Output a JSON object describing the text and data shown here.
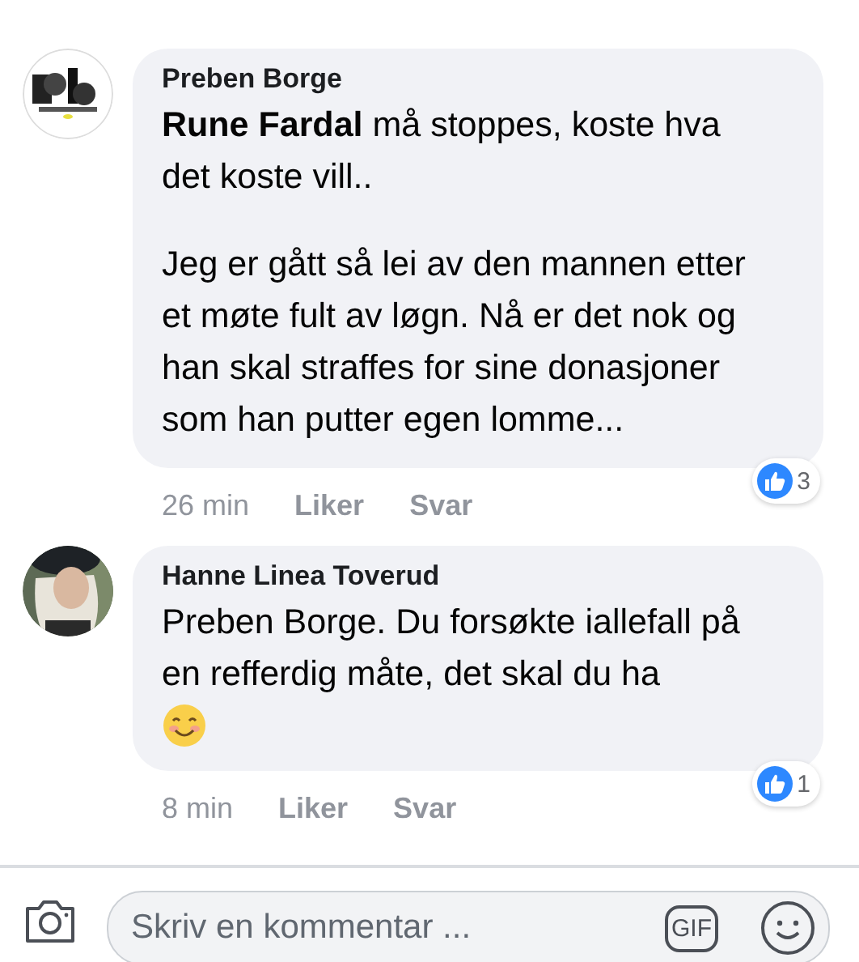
{
  "comments": [
    {
      "author": "Preben Borge",
      "paragraphs": [
        "**Rune Fardal** må stoppes, koste hva det koste vill..",
        "Jeg er gått så lei av den mannen etter et møte fult av løgn. Nå er det nok og han skal straffes for sine donasjoner som han putter egen lomme..."
      ],
      "emoji": false,
      "time": "26 min",
      "like": "Liker",
      "reply": "Svar",
      "reactions": "3"
    },
    {
      "author": "Hanne Linea Toverud",
      "paragraphs": [
        "Preben Borge.  Du forsøkte iallefall på en refferdig måte, det skal du ha"
      ],
      "emoji": true,
      "time": "8 min",
      "like": "Liker",
      "reply": "Svar",
      "reactions": "1"
    }
  ],
  "composer": {
    "placeholder": "Skriv en kommentar ...",
    "gif": "GIF"
  }
}
